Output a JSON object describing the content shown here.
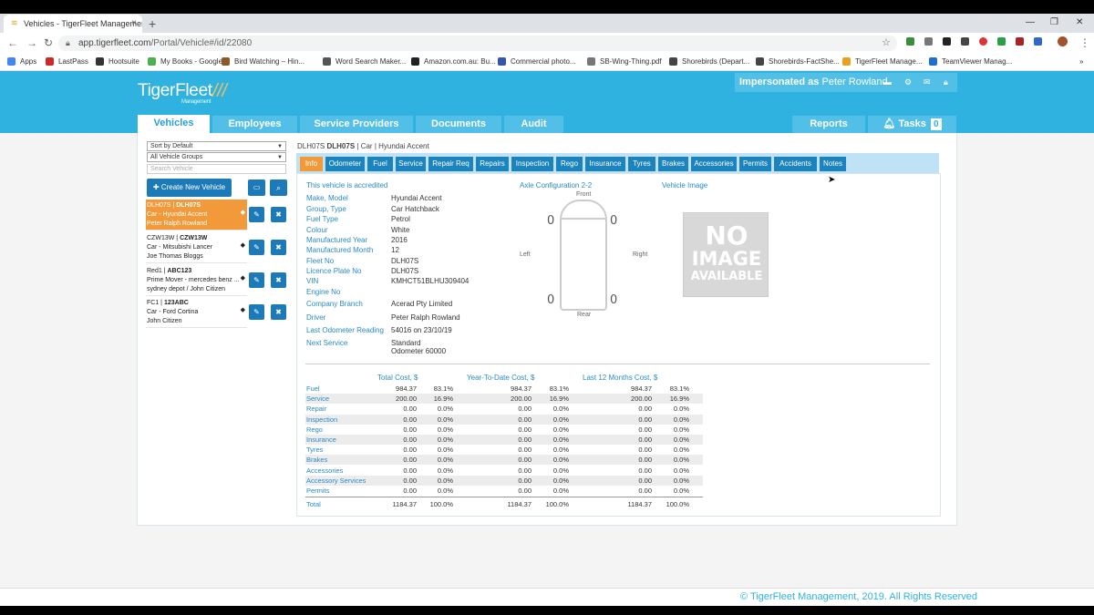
{
  "browser": {
    "tab_title": "Vehicles - TigerFleet Management",
    "tab_close": "×",
    "new_tab": "+",
    "win_min": "—",
    "win_max": "❐",
    "win_close": "✕",
    "url_host": "app.tigerfleet.com",
    "url_path": "/Portal/Vehicle#/id/22080",
    "bookmarks": [
      {
        "label": "Apps",
        "color": "#4285f4"
      },
      {
        "label": "LastPass",
        "color": "#cc2a2a"
      },
      {
        "label": "Hootsuite",
        "color": "#333333"
      },
      {
        "label": "My Books - Google...",
        "color": "#4caf50"
      },
      {
        "label": "Bird Watching – Hin...",
        "color": "#8b5a2b"
      },
      {
        "label": "Word Search Maker...",
        "color": "#555555"
      },
      {
        "label": "Amazon.com.au: Bu...",
        "color": "#222222"
      },
      {
        "label": "Commercial photo...",
        "color": "#3355aa"
      },
      {
        "label": "SB-Wing-Thing.pdf",
        "color": "#777777"
      },
      {
        "label": "Shorebirds (Depart...",
        "color": "#444444"
      },
      {
        "label": "Shorebirds-FactShe...",
        "color": "#444444"
      },
      {
        "label": "TigerFleet Manage...",
        "color": "#e8a21f"
      },
      {
        "label": "TeamViewer Manag...",
        "color": "#1e6fd0"
      }
    ]
  },
  "header": {
    "logo": "TigerFleet",
    "logo_sub": "Management",
    "impersonated_prefix": "Impersonated as",
    "impersonated_user": "Peter Rowland",
    "nav_tabs": [
      "Vehicles",
      "Employees",
      "Service Providers",
      "Documents",
      "Audit"
    ],
    "reports": "Reports",
    "tasks": "Tasks",
    "tasks_count": "0"
  },
  "sidebar": {
    "sort": "Sort by Default",
    "group": "All Vehicle Groups",
    "search_placeholder": "Search Vehicle",
    "create_button": "Create New Vehicle",
    "vehicles": [
      {
        "code": "DLH07S",
        "plate": "DLH07S",
        "desc": "Car - Hyundai Accent",
        "owner": "Peter Ralph Rowland"
      },
      {
        "code": "CZW13W",
        "plate": "CZW13W",
        "desc": "Car - Mitsubishi Lancer",
        "owner": "Joe Thomas Bloggs"
      },
      {
        "code": "Red1",
        "plate": "ABC123",
        "desc": "Prime Mover - mercedes benz ...",
        "owner": "sydney depot / John Citizen"
      },
      {
        "code": "FC1",
        "plate": "123ABC",
        "desc": "Car - Ford Cortina",
        "owner": "John Citizen"
      }
    ]
  },
  "detail": {
    "head_code": "DLH07S",
    "head_plate": "DLH07S",
    "head_rest": "| Car | Hyundai Accent",
    "tabs": [
      "Info",
      "Odometer",
      "Fuel",
      "Service",
      "Repair Req",
      "Repairs",
      "Inspection",
      "Rego",
      "Insurance",
      "Tyres",
      "Brakes",
      "Accessories",
      "Permits",
      "Accidents",
      "Notes"
    ],
    "accredited": "This vehicle is accredited",
    "fields": [
      {
        "label": "Make, Model",
        "value": "Hyundai Accent"
      },
      {
        "label": "Group, Type",
        "value": "Car Hatchback"
      },
      {
        "label": "Fuel Type",
        "value": "Petrol"
      },
      {
        "label": "Colour",
        "value": "White"
      },
      {
        "label": "Manufactured Year",
        "value": "2016"
      },
      {
        "label": "Manufactured Month",
        "value": "12"
      },
      {
        "label": "Fleet No",
        "value": "DLH07S"
      },
      {
        "label": "Licence Plate No",
        "value": "DLH07S"
      },
      {
        "label": "VIN",
        "value": "KMHCT51BLHU309404"
      },
      {
        "label": "Engine No",
        "value": ""
      },
      {
        "label": "Company Branch",
        "value": "Acerad Pty Limited"
      },
      {
        "label": "Driver",
        "value": "Peter Ralph Rowland"
      },
      {
        "label": "Last Odometer Reading",
        "value": "54016 on 23/10/19"
      },
      {
        "label": "Next Service",
        "value": "Standard"
      }
    ],
    "next_service_line2": "Odometer 60000",
    "axle_title": "Axle Configuration 2-2",
    "axle_front": "Front",
    "axle_rear": "Rear",
    "axle_left": "Left",
    "axle_right": "Right",
    "wheel_glyph": "0",
    "vehicle_image_label": "Vehicle Image",
    "no_image": [
      "NO",
      "IMAGE",
      "AVAILABLE"
    ]
  },
  "costs": {
    "headers": [
      "Total Cost, $",
      "Year-To-Date Cost, $",
      "Last 12 Months Cost, $"
    ],
    "rows": [
      {
        "name": "Fuel",
        "t": "984.37",
        "tp": "83.1%",
        "y": "984.37",
        "yp": "83.1%",
        "l": "984.37",
        "lp": "83.1%"
      },
      {
        "name": "Service",
        "t": "200.00",
        "tp": "16.9%",
        "y": "200.00",
        "yp": "16.9%",
        "l": "200.00",
        "lp": "16.9%"
      },
      {
        "name": "Repair",
        "t": "0.00",
        "tp": "0.0%",
        "y": "0.00",
        "yp": "0.0%",
        "l": "0.00",
        "lp": "0.0%"
      },
      {
        "name": "Inspection",
        "t": "0.00",
        "tp": "0.0%",
        "y": "0.00",
        "yp": "0.0%",
        "l": "0.00",
        "lp": "0.0%"
      },
      {
        "name": "Rego",
        "t": "0.00",
        "tp": "0.0%",
        "y": "0.00",
        "yp": "0.0%",
        "l": "0.00",
        "lp": "0.0%"
      },
      {
        "name": "Insurance",
        "t": "0.00",
        "tp": "0.0%",
        "y": "0.00",
        "yp": "0.0%",
        "l": "0.00",
        "lp": "0.0%"
      },
      {
        "name": "Tyres",
        "t": "0.00",
        "tp": "0.0%",
        "y": "0.00",
        "yp": "0.0%",
        "l": "0.00",
        "lp": "0.0%"
      },
      {
        "name": "Brakes",
        "t": "0.00",
        "tp": "0.0%",
        "y": "0.00",
        "yp": "0.0%",
        "l": "0.00",
        "lp": "0.0%"
      },
      {
        "name": "Accessories",
        "t": "0.00",
        "tp": "0.0%",
        "y": "0.00",
        "yp": "0.0%",
        "l": "0.00",
        "lp": "0.0%"
      },
      {
        "name": "Accessory Services",
        "t": "0.00",
        "tp": "0.0%",
        "y": "0.00",
        "yp": "0.0%",
        "l": "0.00",
        "lp": "0.0%"
      },
      {
        "name": "Permits",
        "t": "0.00",
        "tp": "0.0%",
        "y": "0.00",
        "yp": "0.0%",
        "l": "0.00",
        "lp": "0.0%"
      }
    ],
    "total": {
      "name": "Total",
      "t": "1184.37",
      "tp": "100.0%",
      "y": "1184.37",
      "yp": "100.0%",
      "l": "1184.37",
      "lp": "100.0%"
    }
  },
  "footer": "© TigerFleet Management, 2019. All Rights Reserved",
  "colors": {
    "brand": "#2fb2e0",
    "accent_orange": "#f29a3a",
    "button_blue": "#1d7ab9"
  }
}
